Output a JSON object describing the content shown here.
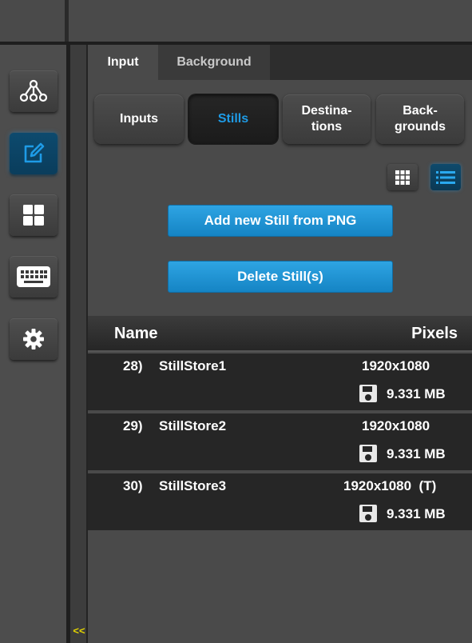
{
  "left_rail": {
    "items": [
      {
        "name": "network",
        "icon": "network-tree-icon",
        "active": false
      },
      {
        "name": "edit",
        "icon": "edit-pencil-icon",
        "active": true
      },
      {
        "name": "layouts",
        "icon": "grid-squares-icon",
        "active": false
      },
      {
        "name": "keyboard",
        "icon": "keyboard-icon",
        "active": false
      },
      {
        "name": "settings",
        "icon": "gear-icon",
        "active": false
      }
    ],
    "collapse_label": "<<"
  },
  "tabs": [
    {
      "label": "Input",
      "active": true
    },
    {
      "label": "Background",
      "active": false
    }
  ],
  "segments": [
    {
      "label": "Inputs",
      "active": false
    },
    {
      "label": "Stills",
      "active": true
    },
    {
      "label": "Destina-\ntions",
      "active": false
    },
    {
      "label": "Back-\ngrounds",
      "active": false
    }
  ],
  "view_toggle": {
    "grid": "grid-view-icon",
    "list": "list-view-icon",
    "selected": "list"
  },
  "buttons": {
    "add_still": "Add new Still from PNG",
    "delete_still": "Delete Still(s)"
  },
  "table": {
    "headers": {
      "name": "Name",
      "pixels": "Pixels"
    },
    "rows": [
      {
        "index": "28)",
        "name": "StillStore1",
        "pixels": "1920x1080",
        "size": "9.331 MB"
      },
      {
        "index": "29)",
        "name": "StillStore2",
        "pixels": "1920x1080",
        "size": "9.331 MB"
      },
      {
        "index": "30)",
        "name": "StillStore3",
        "pixels": "1920x1080  (T)",
        "size": "9.331 MB"
      }
    ]
  },
  "colors": {
    "accent": "#1e9be6",
    "button": "#1d8fd2",
    "collapse_arrow": "#e3d400"
  }
}
